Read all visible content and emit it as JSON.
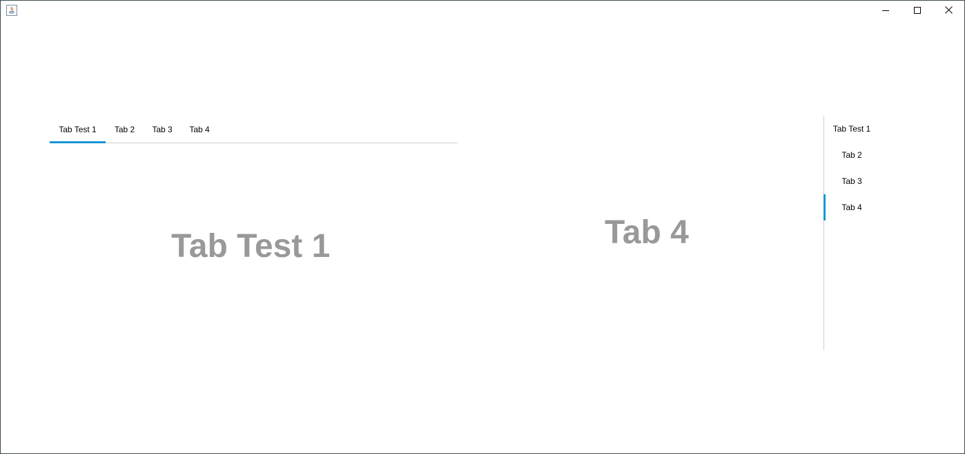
{
  "window": {
    "icon": "java-app-icon",
    "controls": {
      "minimize_icon": "minimize-icon",
      "maximize_icon": "maximize-icon",
      "close_icon": "close-icon"
    }
  },
  "top_tabs": {
    "tabs": [
      {
        "label": "Tab Test 1",
        "selected": true
      },
      {
        "label": "Tab 2",
        "selected": false
      },
      {
        "label": "Tab 3",
        "selected": false
      },
      {
        "label": "Tab 4",
        "selected": false
      }
    ],
    "content_label": "Tab Test 1"
  },
  "right_tabs": {
    "tabs": [
      {
        "label": "Tab Test 1",
        "selected": false
      },
      {
        "label": "Tab 2",
        "selected": false
      },
      {
        "label": "Tab 3",
        "selected": false
      },
      {
        "label": "Tab 4",
        "selected": true
      }
    ],
    "content_label": "Tab 4"
  },
  "colors": {
    "accent": "#1796d2",
    "content_text": "#999999",
    "separator": "#cfcfcf"
  }
}
